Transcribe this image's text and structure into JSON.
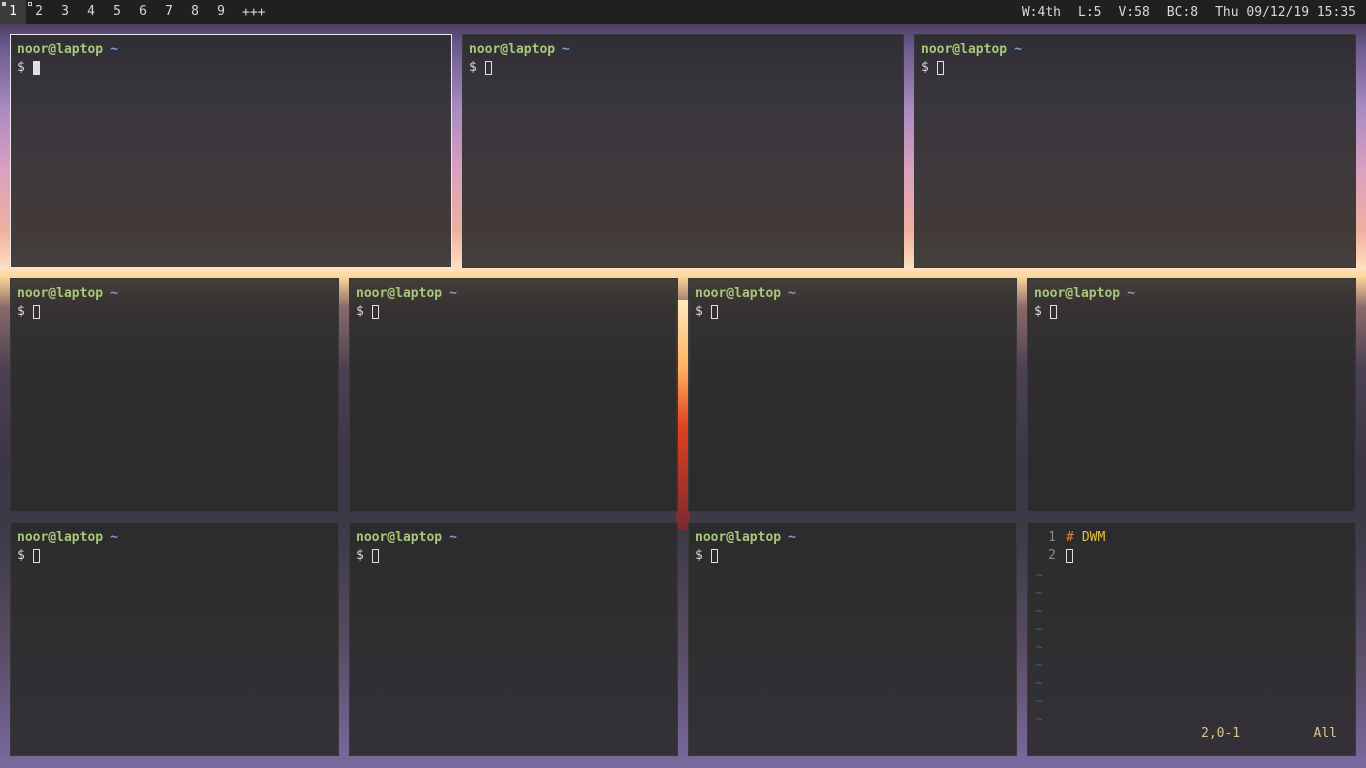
{
  "bar": {
    "tags": [
      "1",
      "2",
      "3",
      "4",
      "5",
      "6",
      "7",
      "8",
      "9"
    ],
    "active_tag": "1",
    "layout_symbol": "+++",
    "status": {
      "workspace": "W:4th",
      "l": "L:5",
      "volume": "V:58",
      "bc": "BC:8",
      "datetime": "Thu 09/12/19 15:35"
    }
  },
  "terminal": {
    "user_host": "noor@laptop",
    "cwd": "~",
    "prompt": "$"
  },
  "vim": {
    "lines": [
      {
        "num": "1",
        "hash": "#",
        "text": "DWM"
      },
      {
        "num": "2",
        "text": ""
      }
    ],
    "filler": [
      "~",
      "~",
      "~",
      "~",
      "~",
      "~",
      "~",
      "~",
      "~"
    ],
    "position": "2,0-1",
    "scroll": "All"
  },
  "colors": {
    "bar_bg": "#202020",
    "prompt_user": "#a8c87a",
    "prompt_dir": "#7aa0d8",
    "focus_border": "#e8e8e8"
  }
}
